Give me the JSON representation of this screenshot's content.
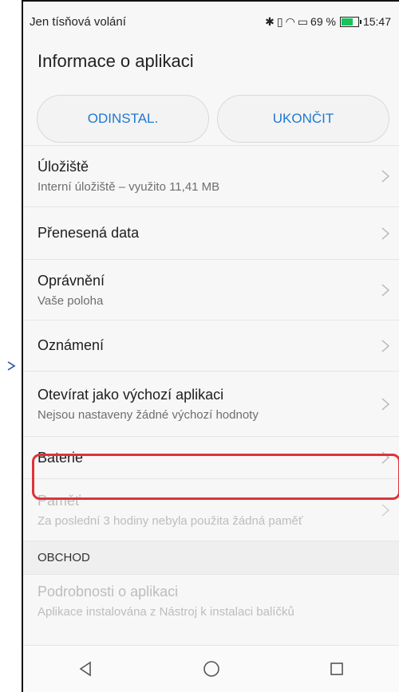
{
  "status_bar": {
    "carrier": "Jen tísňová volání",
    "battery_percent": "69 %",
    "time": "15:47",
    "icons": [
      "bluetooth-icon",
      "vibrate-icon",
      "wifi-icon",
      "sim-icon",
      "battery-icon"
    ],
    "battery_color": "#19c25b"
  },
  "app_bar": {
    "title": "Informace o aplikaci"
  },
  "actions": {
    "uninstall_label": "ODINSTAL.",
    "stop_label": "UKONČIT",
    "accent": "#1f78d1"
  },
  "items": [
    {
      "title": "Úložiště",
      "subtitle": "Interní úložiště – využito 11,41 MB"
    },
    {
      "title": "Přenesená data"
    },
    {
      "title": "Oprávnění",
      "subtitle": "Vaše poloha"
    },
    {
      "title": "Oznámení"
    },
    {
      "title": "Otevírat jako výchozí aplikaci",
      "subtitle": "Nejsou nastaveny žádné výchozí hodnoty"
    },
    {
      "title": "Baterie",
      "highlighted": true
    },
    {
      "title": "Paměť",
      "subtitle": "Za poslední 3 hodiny nebyla použita žádná paměť",
      "disabled": true
    }
  ],
  "section_header": "OBCHOD",
  "store_item": {
    "title": "Podrobnosti o aplikaci",
    "subtitle": "Aplikace instalována z Nástroj k instalaci balíčků",
    "disabled": true
  },
  "highlight_color": "#e0323a",
  "nav": [
    "back-icon",
    "home-icon",
    "recents-icon"
  ]
}
